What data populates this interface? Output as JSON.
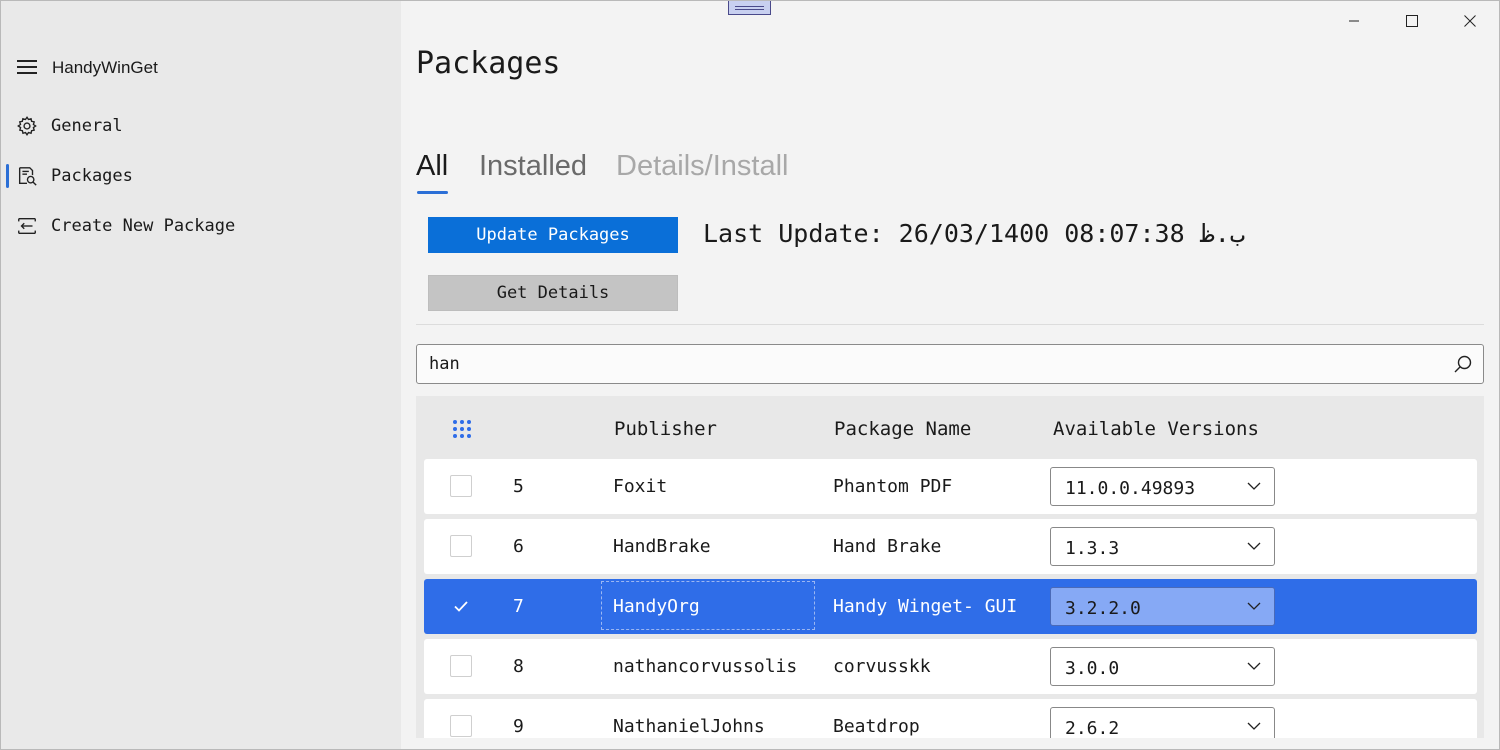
{
  "app": {
    "title": "HandyWinGet"
  },
  "sidebar": {
    "items": [
      {
        "label": "General",
        "icon": "gear-icon"
      },
      {
        "label": "Packages",
        "icon": "package-search-icon",
        "selected": true
      },
      {
        "label": "Create New Package",
        "icon": "create-package-icon"
      }
    ]
  },
  "window_controls": [
    "minimize-icon",
    "maximize-icon",
    "close-icon"
  ],
  "page": {
    "title": "Packages",
    "tabs": [
      {
        "label": "All",
        "active": true
      },
      {
        "label": "Installed",
        "active": false
      },
      {
        "label": "Details/Install",
        "active": false,
        "disabled": true
      }
    ],
    "update_button": "Update Packages",
    "details_button": "Get Details",
    "last_update": "Last Update: 26/03/1400 08:07:38 ب.ظ",
    "search": {
      "value": "han"
    }
  },
  "grid": {
    "columns": [
      "Publisher",
      "Package Name",
      "Available Versions"
    ],
    "rows": [
      {
        "num": "5",
        "publisher": "Foxit",
        "package": "Phantom PDF",
        "version": "11.0.0.49893",
        "checked": false
      },
      {
        "num": "6",
        "publisher": "HandBrake",
        "package": "Hand Brake",
        "version": "1.3.3",
        "checked": false
      },
      {
        "num": "7",
        "publisher": "HandyOrg",
        "package": "Handy Winget- GUI",
        "version": "3.2.2.0",
        "checked": true
      },
      {
        "num": "8",
        "publisher": "nathancorvussolis",
        "package": "corvusskk",
        "version": "3.0.0",
        "checked": false
      },
      {
        "num": "9",
        "publisher": "NathanielJohns",
        "package": "Beatdrop",
        "version": "2.6.2",
        "checked": false
      }
    ]
  },
  "colors": {
    "accent": "#0a6fd8",
    "selected_row": "#2f6de8",
    "sidebar_bg": "#e9e9e9"
  }
}
